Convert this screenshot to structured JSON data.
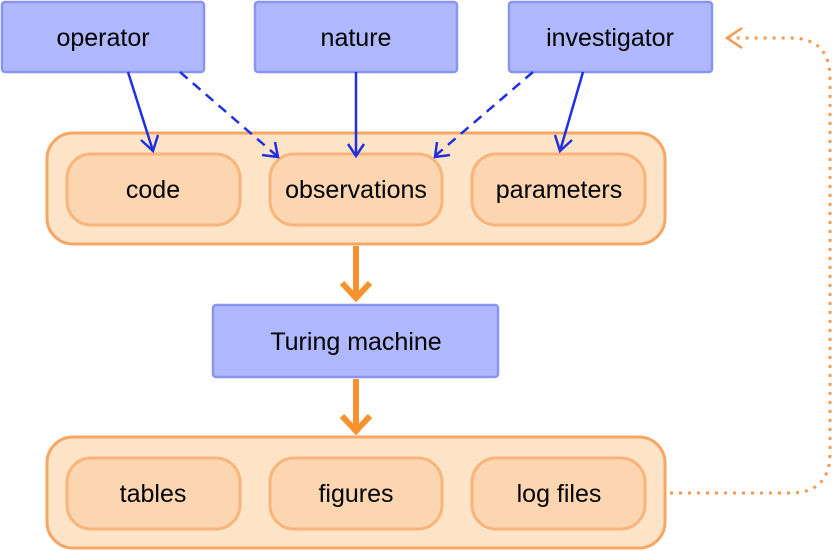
{
  "sources": [
    "operator",
    "nature",
    "investigator"
  ],
  "inputs": [
    "code",
    "observations",
    "parameters"
  ],
  "processor": "Turing machine",
  "outputs": [
    "tables",
    "figures",
    "log files"
  ],
  "colors": {
    "source_fill": "#b0b8fd",
    "container_fill": "#fde4c6",
    "item_fill": "#fcd5b1",
    "blue_arrow": "#1f30e0",
    "orange_arrow": "#f7922f"
  },
  "edges": [
    {
      "from": "operator",
      "to": "code",
      "style": "solid"
    },
    {
      "from": "operator",
      "to": "observations",
      "style": "dashed"
    },
    {
      "from": "nature",
      "to": "observations",
      "style": "solid"
    },
    {
      "from": "investigator",
      "to": "observations",
      "style": "dashed"
    },
    {
      "from": "investigator",
      "to": "parameters",
      "style": "solid"
    },
    {
      "from": "inputs",
      "to": "Turing machine",
      "style": "thick"
    },
    {
      "from": "Turing machine",
      "to": "outputs",
      "style": "thick"
    },
    {
      "from": "outputs",
      "to": "investigator",
      "style": "dotted"
    }
  ]
}
